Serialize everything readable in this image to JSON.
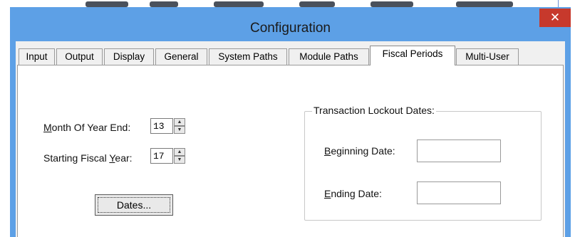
{
  "window": {
    "title": "Configuration",
    "close_glyph": "✕"
  },
  "tabs": [
    {
      "label": "Input",
      "active": false
    },
    {
      "label": "Output",
      "active": false
    },
    {
      "label": "Display",
      "active": false
    },
    {
      "label": "General",
      "active": false
    },
    {
      "label": "System Paths",
      "active": false
    },
    {
      "label": "Module Paths",
      "active": false
    },
    {
      "label": "Fiscal Periods",
      "active": true
    },
    {
      "label": "Multi-User",
      "active": false
    }
  ],
  "fiscal": {
    "month_label_ul": "M",
    "month_label_rest": "onth Of Year End:",
    "month_value": "13",
    "year_label_pre": "Starting Fiscal ",
    "year_label_ul": "Y",
    "year_label_rest": "ear:",
    "year_value": "17",
    "dates_button": "Dates...",
    "spin_up": "▲",
    "spin_down": "▼"
  },
  "lockout": {
    "group_title": "Transaction Lockout Dates:",
    "begin_ul": "B",
    "begin_rest": "eginning Date:",
    "begin_value": "",
    "end_ul": "E",
    "end_rest": "nding Date:",
    "end_value": ""
  },
  "colors": {
    "titlebar": "#5da0e6",
    "close": "#c7392c"
  }
}
